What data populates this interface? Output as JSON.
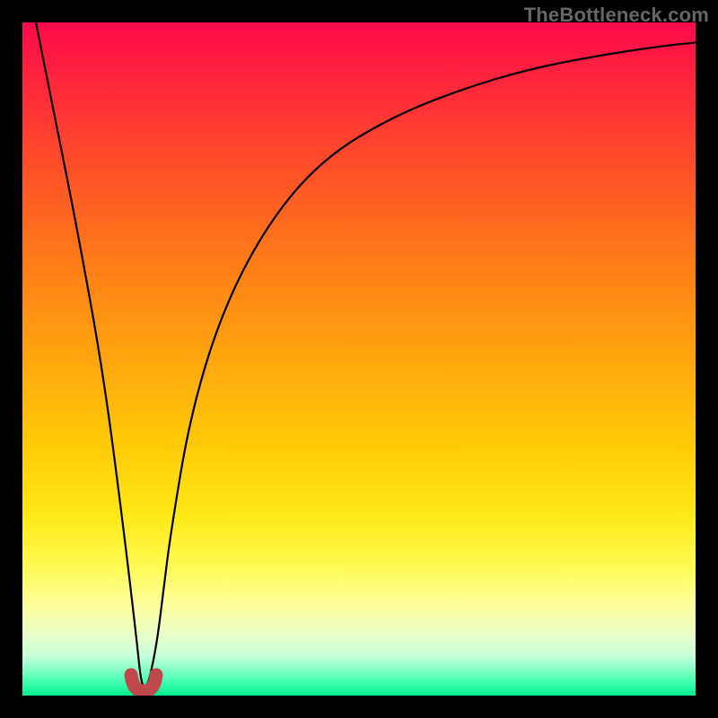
{
  "watermark": "TheBottleneck.com",
  "colors": {
    "top": "#ff0a4a",
    "mid": "#ffe814",
    "bottom": "#00f090",
    "frame": "#000000",
    "curve": "#000000",
    "bump": "#c1484a"
  },
  "chart_data": {
    "type": "line",
    "title": "",
    "xlabel": "",
    "ylabel": "",
    "xlim": [
      0,
      100
    ],
    "ylim": [
      0,
      100
    ],
    "series": [
      {
        "name": "bottleneck-curve",
        "x": [
          2,
          5,
          8,
          12,
          15,
          17,
          17.5,
          18,
          18.5,
          19,
          20,
          21,
          22,
          25,
          30,
          37,
          45,
          55,
          65,
          75,
          85,
          95,
          100
        ],
        "values": [
          100,
          85,
          70,
          48,
          25,
          8,
          3,
          1,
          1.5,
          3,
          8,
          16,
          24,
          42,
          58,
          71,
          80,
          86,
          90,
          93,
          95,
          96.5,
          97
        ]
      }
    ],
    "annotations": [
      {
        "name": "minimum-bump",
        "x": 18,
        "y": 1.2
      }
    ]
  }
}
